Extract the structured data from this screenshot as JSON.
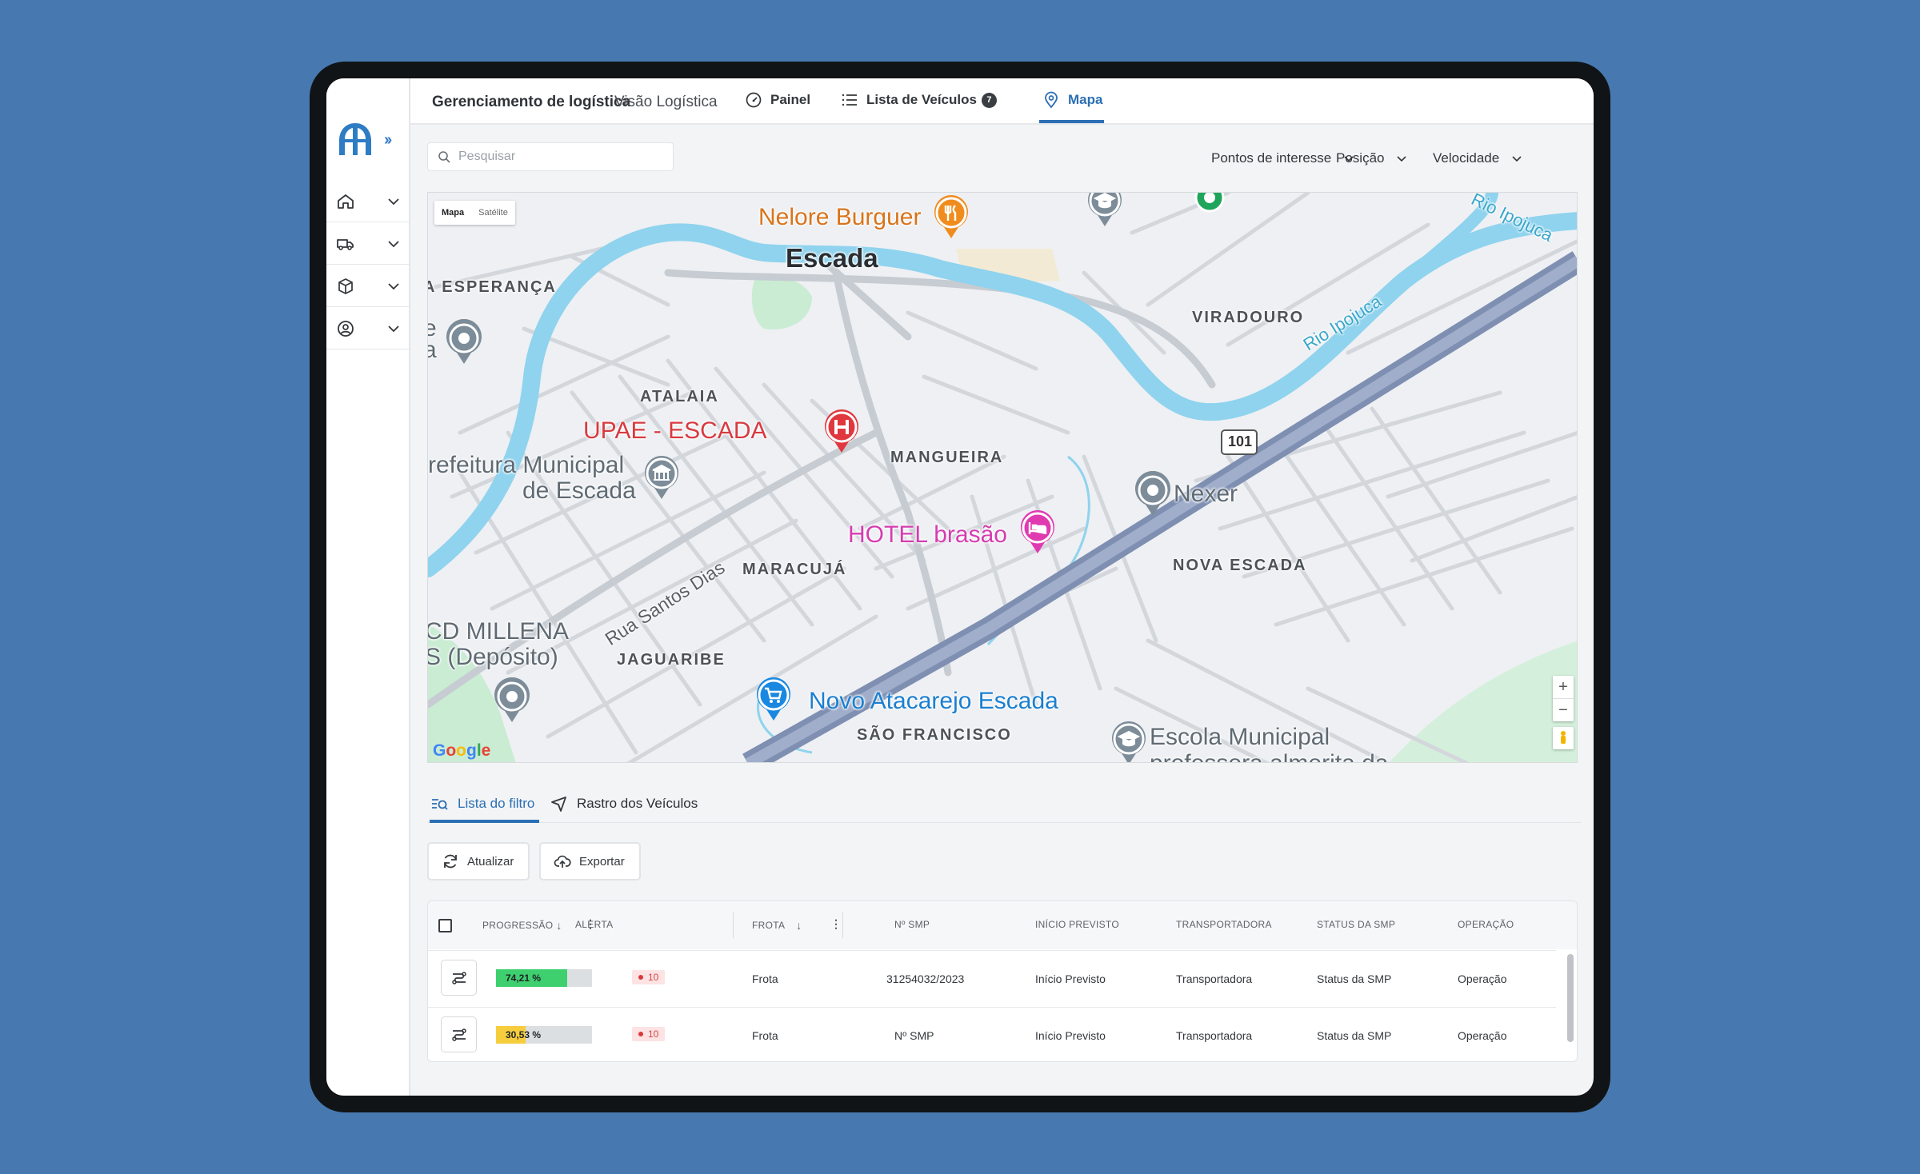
{
  "header": {
    "title": "Gerenciamento de logística",
    "subtitle": "Visão Logística",
    "nav": [
      {
        "label": "Painel",
        "icon": "gauge-icon"
      },
      {
        "label": "Lista de Veículos",
        "icon": "list-icon",
        "count": "7"
      },
      {
        "label": "Mapa",
        "icon": "map-pin-icon",
        "active": true
      }
    ]
  },
  "toolbar": {
    "search_placeholder": "Pesquisar",
    "filters": [
      "Pontos de interesse",
      "Posição",
      "Velocidade"
    ]
  },
  "map": {
    "toggle": {
      "map": "Mapa",
      "satellite": "Satélite"
    },
    "zoom_in": "+",
    "zoom_out": "−",
    "labels": {
      "nelore": "Nelore Burguer",
      "escada": "Escada",
      "esperanca": "A ESPERANÇA",
      "viradouro": "VIRADOURO",
      "rio1": "Rio Ipojuca",
      "rio2": "Rio Ipojuca",
      "atalaia": "ATALAIA",
      "upae": "UPAE - ESCADA",
      "prefeitura1": "refeitura Municipal",
      "prefeitura2": "de Escada",
      "mangueira": "MANGUEIRA",
      "route": "101",
      "nexer": "Nexer",
      "hotel": "HOTEL brasão",
      "nova_escada": "NOVA ESCADA",
      "maracuja": "MARACUJÁ",
      "rua_santos": "Rua Santos Dias",
      "millena1": "CD MILLENA",
      "millena2": "S (Depósito)",
      "jaguaribe": "JAGUARIBE",
      "atacarejo": "Novo Atacarejo Escada",
      "sao_francisco": "SÃO FRANCISCO",
      "escola1": "Escola Municipal",
      "escola2": "professora almerita da",
      "edge_e": "e",
      "edge_a": "a"
    },
    "google": [
      "G",
      "o",
      "o",
      "g",
      "l",
      "e"
    ]
  },
  "bottom_tabs": [
    {
      "label": "Lista do filtro",
      "active": true
    },
    {
      "label": "Rastro dos Veículos"
    }
  ],
  "actions": {
    "refresh": "Atualizar",
    "export": "Exportar"
  },
  "table": {
    "columns": {
      "progress": "PROGRESSÃO",
      "alert": "ALERTA",
      "fleet": "FROTA",
      "smp_number": "Nº SMP",
      "start": "INÍCIO PREVISTO",
      "carrier": "TRANSPORTADORA",
      "smp_status": "STATUS DA SMP",
      "operation": "OPERAÇÃO"
    },
    "sort_arrow": "↓",
    "kebab": "⋮",
    "rows": [
      {
        "progress": "74,21 %",
        "progress_value": 0.7421,
        "progress_color": "#3ecf6f",
        "alert": "10",
        "fleet": "Frota",
        "smp_number": "31254032/2023",
        "start": "Início Previsto",
        "carrier": "Transportadora",
        "smp_status": "Status da SMP",
        "operation": "Operação"
      },
      {
        "progress": "30,53 %",
        "progress_value": 0.3053,
        "progress_color": "#f5cd3d",
        "alert": "10",
        "fleet": "Frota",
        "smp_number": "Nº SMP",
        "start": "Início Previsto",
        "carrier": "Transportadora",
        "smp_status": "Status da SMP",
        "operation": "Operação"
      }
    ]
  },
  "colors": {
    "accent": "#2c6fb5",
    "background": "#4779B0",
    "water": "#8fd3ee",
    "park": "#c9ecd3",
    "highway": "#8f9fbf"
  }
}
